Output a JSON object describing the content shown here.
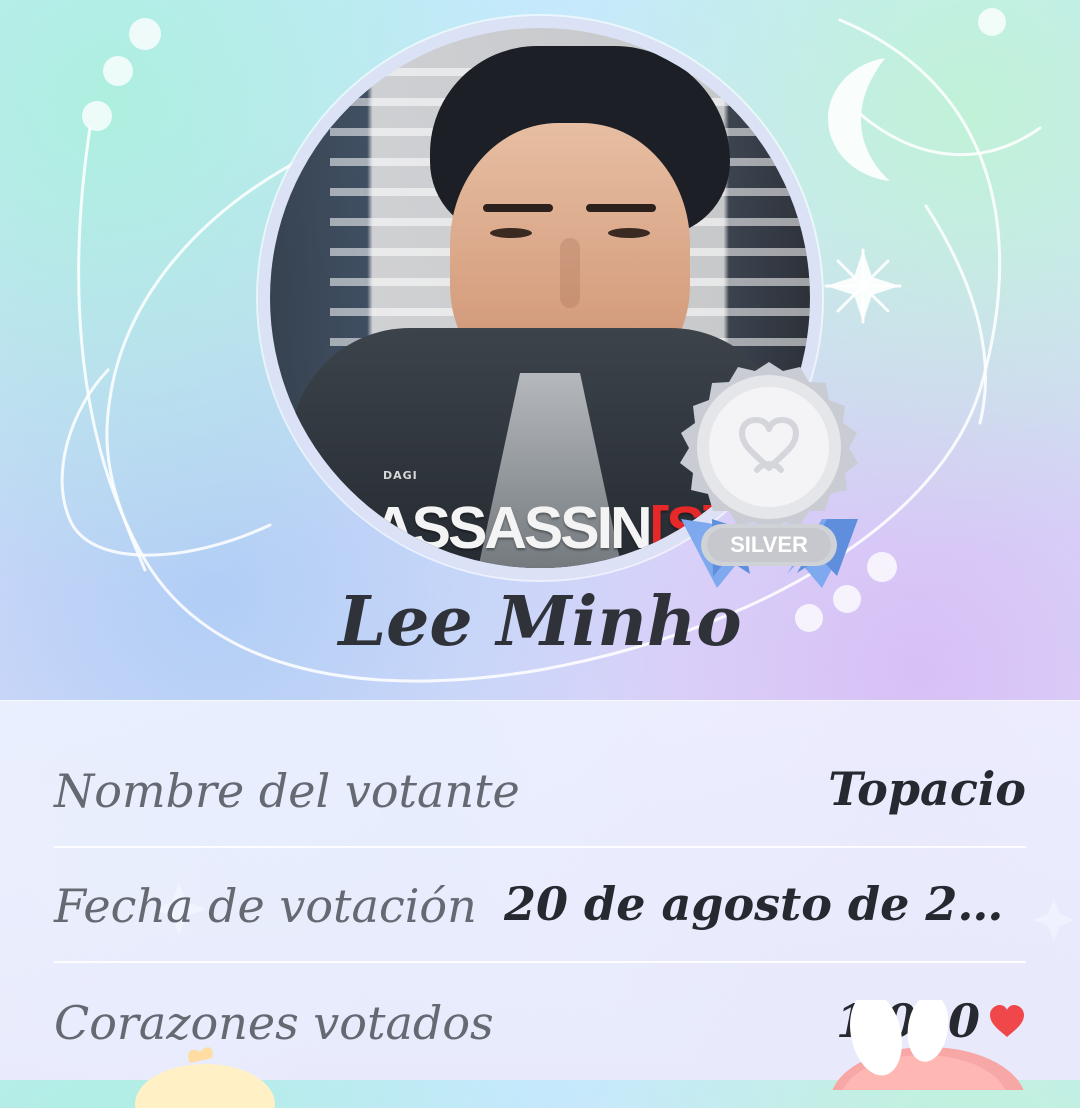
{
  "hero": {
    "poster_small_text": "DAGI",
    "poster_text": "ASSASSIN",
    "poster_suffix": "[S]",
    "badge_label": "SILVER",
    "artist_name": "Lee Minho"
  },
  "details": [
    {
      "label": "Nombre del votante",
      "value": "Topacio"
    },
    {
      "label": "Fecha de votación",
      "value": "20 de agosto de 202..."
    },
    {
      "label": "Corazones votados",
      "value": "1.000",
      "icon": "heart-icon"
    }
  ],
  "colors": {
    "text_primary": "#26292f",
    "text_secondary": "#646972",
    "badge_silver": "#cfd2d7",
    "badge_ribbon": "#6e9ae7",
    "heart": "#f0474a"
  }
}
